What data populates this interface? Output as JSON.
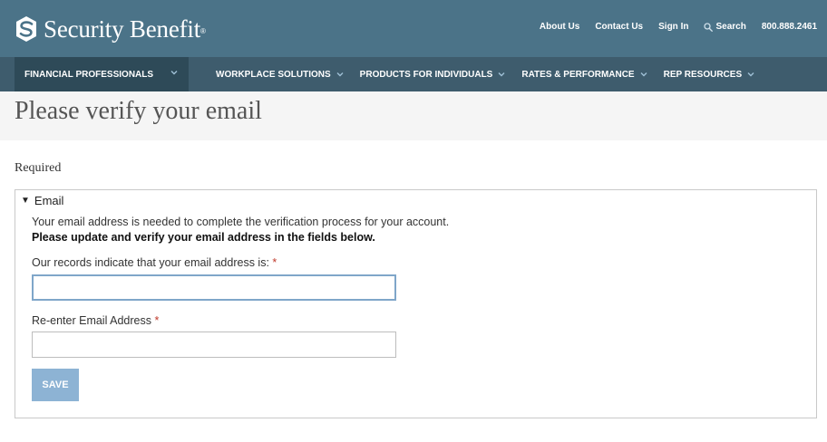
{
  "header": {
    "brand": "Security Benefit",
    "brand_mark": "®",
    "utility": {
      "about": "About Us",
      "contact": "Contact Us",
      "sign_in": "Sign In",
      "search": "Search",
      "phone": "800.888.2461"
    }
  },
  "nav": {
    "audience": "FINANCIAL PROFESSIONALS",
    "items": [
      "WORKPLACE SOLUTIONS",
      "PRODUCTS FOR INDIVIDUALS",
      "RATES & PERFORMANCE",
      "REP RESOURCES"
    ]
  },
  "page": {
    "title": "Please verify your email",
    "required": "Required"
  },
  "form": {
    "section_label": "Email",
    "info_line": "Your email address is needed to complete the verification process for your account.",
    "info_bold": "Please update and verify your email address in the fields below.",
    "field1_label": "Our records indicate that your email address is:",
    "field1_value": "",
    "field2_label": "Re-enter Email Address",
    "field2_value": "",
    "required_marker": "*",
    "save_label": "SAVE"
  },
  "colors": {
    "header_bg": "#4b7388",
    "nav_bg": "#3e5c6d",
    "nav_active_bg": "#2e4a58",
    "save_button": "#8db3d4",
    "focus_border": "#7fa6c9",
    "required_star": "#c0392b"
  },
  "icons": {
    "logo": "security-benefit-logo-icon",
    "search": "search-icon",
    "chevron": "chevron-down-icon",
    "disclosure": "triangle-down-icon"
  }
}
